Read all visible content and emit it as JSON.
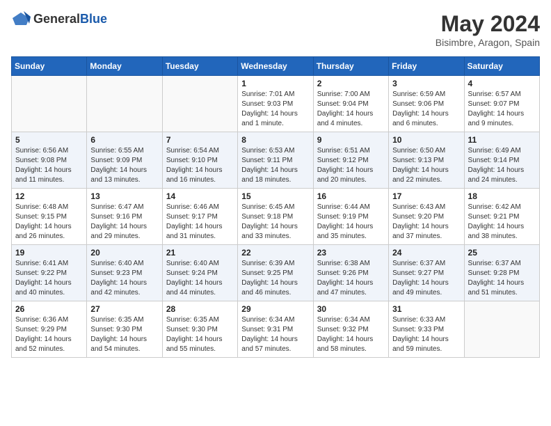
{
  "header": {
    "logo_general": "General",
    "logo_blue": "Blue",
    "title": "May 2024",
    "location": "Bisimbre, Aragon, Spain"
  },
  "days_of_week": [
    "Sunday",
    "Monday",
    "Tuesday",
    "Wednesday",
    "Thursday",
    "Friday",
    "Saturday"
  ],
  "weeks": [
    {
      "alt": false,
      "days": [
        {
          "num": "",
          "info": ""
        },
        {
          "num": "",
          "info": ""
        },
        {
          "num": "",
          "info": ""
        },
        {
          "num": "1",
          "info": "Sunrise: 7:01 AM\nSunset: 9:03 PM\nDaylight: 14 hours\nand 1 minute."
        },
        {
          "num": "2",
          "info": "Sunrise: 7:00 AM\nSunset: 9:04 PM\nDaylight: 14 hours\nand 4 minutes."
        },
        {
          "num": "3",
          "info": "Sunrise: 6:59 AM\nSunset: 9:06 PM\nDaylight: 14 hours\nand 6 minutes."
        },
        {
          "num": "4",
          "info": "Sunrise: 6:57 AM\nSunset: 9:07 PM\nDaylight: 14 hours\nand 9 minutes."
        }
      ]
    },
    {
      "alt": true,
      "days": [
        {
          "num": "5",
          "info": "Sunrise: 6:56 AM\nSunset: 9:08 PM\nDaylight: 14 hours\nand 11 minutes."
        },
        {
          "num": "6",
          "info": "Sunrise: 6:55 AM\nSunset: 9:09 PM\nDaylight: 14 hours\nand 13 minutes."
        },
        {
          "num": "7",
          "info": "Sunrise: 6:54 AM\nSunset: 9:10 PM\nDaylight: 14 hours\nand 16 minutes."
        },
        {
          "num": "8",
          "info": "Sunrise: 6:53 AM\nSunset: 9:11 PM\nDaylight: 14 hours\nand 18 minutes."
        },
        {
          "num": "9",
          "info": "Sunrise: 6:51 AM\nSunset: 9:12 PM\nDaylight: 14 hours\nand 20 minutes."
        },
        {
          "num": "10",
          "info": "Sunrise: 6:50 AM\nSunset: 9:13 PM\nDaylight: 14 hours\nand 22 minutes."
        },
        {
          "num": "11",
          "info": "Sunrise: 6:49 AM\nSunset: 9:14 PM\nDaylight: 14 hours\nand 24 minutes."
        }
      ]
    },
    {
      "alt": false,
      "days": [
        {
          "num": "12",
          "info": "Sunrise: 6:48 AM\nSunset: 9:15 PM\nDaylight: 14 hours\nand 26 minutes."
        },
        {
          "num": "13",
          "info": "Sunrise: 6:47 AM\nSunset: 9:16 PM\nDaylight: 14 hours\nand 29 minutes."
        },
        {
          "num": "14",
          "info": "Sunrise: 6:46 AM\nSunset: 9:17 PM\nDaylight: 14 hours\nand 31 minutes."
        },
        {
          "num": "15",
          "info": "Sunrise: 6:45 AM\nSunset: 9:18 PM\nDaylight: 14 hours\nand 33 minutes."
        },
        {
          "num": "16",
          "info": "Sunrise: 6:44 AM\nSunset: 9:19 PM\nDaylight: 14 hours\nand 35 minutes."
        },
        {
          "num": "17",
          "info": "Sunrise: 6:43 AM\nSunset: 9:20 PM\nDaylight: 14 hours\nand 37 minutes."
        },
        {
          "num": "18",
          "info": "Sunrise: 6:42 AM\nSunset: 9:21 PM\nDaylight: 14 hours\nand 38 minutes."
        }
      ]
    },
    {
      "alt": true,
      "days": [
        {
          "num": "19",
          "info": "Sunrise: 6:41 AM\nSunset: 9:22 PM\nDaylight: 14 hours\nand 40 minutes."
        },
        {
          "num": "20",
          "info": "Sunrise: 6:40 AM\nSunset: 9:23 PM\nDaylight: 14 hours\nand 42 minutes."
        },
        {
          "num": "21",
          "info": "Sunrise: 6:40 AM\nSunset: 9:24 PM\nDaylight: 14 hours\nand 44 minutes."
        },
        {
          "num": "22",
          "info": "Sunrise: 6:39 AM\nSunset: 9:25 PM\nDaylight: 14 hours\nand 46 minutes."
        },
        {
          "num": "23",
          "info": "Sunrise: 6:38 AM\nSunset: 9:26 PM\nDaylight: 14 hours\nand 47 minutes."
        },
        {
          "num": "24",
          "info": "Sunrise: 6:37 AM\nSunset: 9:27 PM\nDaylight: 14 hours\nand 49 minutes."
        },
        {
          "num": "25",
          "info": "Sunrise: 6:37 AM\nSunset: 9:28 PM\nDaylight: 14 hours\nand 51 minutes."
        }
      ]
    },
    {
      "alt": false,
      "days": [
        {
          "num": "26",
          "info": "Sunrise: 6:36 AM\nSunset: 9:29 PM\nDaylight: 14 hours\nand 52 minutes."
        },
        {
          "num": "27",
          "info": "Sunrise: 6:35 AM\nSunset: 9:30 PM\nDaylight: 14 hours\nand 54 minutes."
        },
        {
          "num": "28",
          "info": "Sunrise: 6:35 AM\nSunset: 9:30 PM\nDaylight: 14 hours\nand 55 minutes."
        },
        {
          "num": "29",
          "info": "Sunrise: 6:34 AM\nSunset: 9:31 PM\nDaylight: 14 hours\nand 57 minutes."
        },
        {
          "num": "30",
          "info": "Sunrise: 6:34 AM\nSunset: 9:32 PM\nDaylight: 14 hours\nand 58 minutes."
        },
        {
          "num": "31",
          "info": "Sunrise: 6:33 AM\nSunset: 9:33 PM\nDaylight: 14 hours\nand 59 minutes."
        },
        {
          "num": "",
          "info": ""
        }
      ]
    }
  ]
}
